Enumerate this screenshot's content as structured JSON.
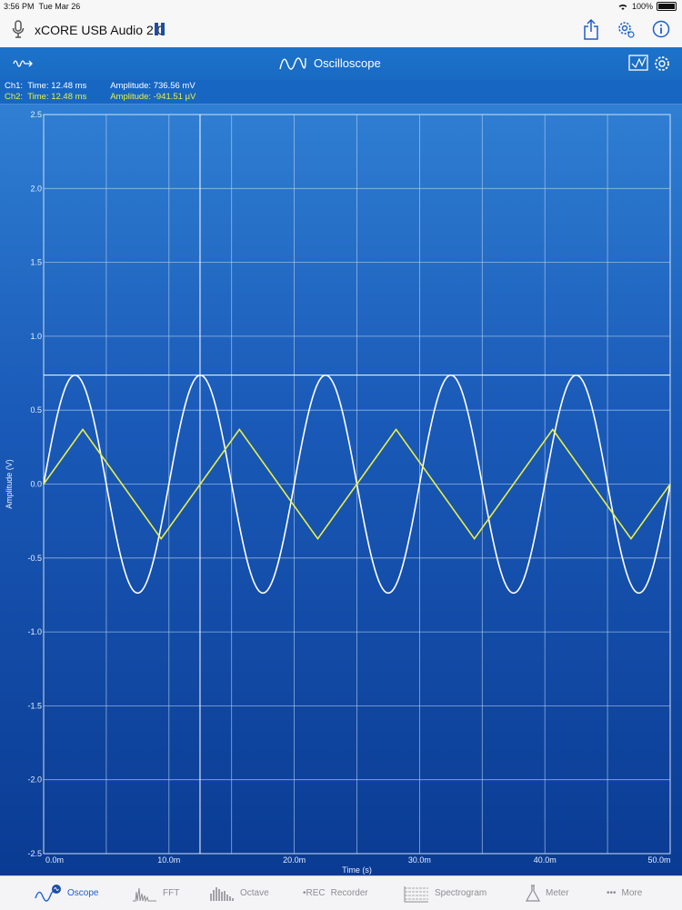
{
  "status_bar": {
    "time": "3:56 PM",
    "date": "Tue Mar 26",
    "battery": "100%",
    "wifi_icon": "wifi-icon",
    "battery_icon": "battery-icon"
  },
  "title_bar": {
    "device_name": "xCORE USB Audio 2.0",
    "mic_icon": "microphone-icon",
    "pause_icon": "pause-icon",
    "share_icon": "share-icon",
    "settings_icon": "gear-icon",
    "info_icon": "info-icon"
  },
  "scope_header": {
    "title": "Oscilloscope",
    "wave_icon": "sine-wave-icon",
    "trigger_icon": "trigger-icon",
    "display_icon": "display-mode-icon",
    "settings_icon": "gear-icon"
  },
  "readout": {
    "ch1_label": "Ch1:",
    "ch1_time": "Time: 12.48 ms",
    "ch1_amp": "Amplitude: 736.56 mV",
    "ch2_label": "Ch2:",
    "ch2_time": "Time: 12.48 ms",
    "ch2_amp": "Amplitude: -941.51 µV"
  },
  "chart_data": {
    "type": "line",
    "xlabel": "Time (s)",
    "ylabel": "Amplitude (V)",
    "xlim": [
      0,
      50
    ],
    "ylim": [
      -2.5,
      2.5
    ],
    "x_ticks": [
      "0.0m",
      "10.0m",
      "20.0m",
      "30.0m",
      "40.0m",
      "50.0m"
    ],
    "y_ticks": [
      "2.5",
      "2.0",
      "1.5",
      "1.0",
      "0.5",
      "0.0",
      "-0.5",
      "-1.0",
      "-1.5",
      "-2.0",
      "-2.5"
    ],
    "grid": true,
    "cursor": {
      "x": 12.48,
      "y": 0.737
    },
    "series": [
      {
        "type": "sine",
        "amplitude": 0.737,
        "period": 10,
        "phase": 0,
        "color": "#ffffff"
      },
      {
        "type": "triangle",
        "amplitude": 0.37,
        "period": 12.5,
        "phase": 0,
        "color": "#e9ef45"
      }
    ]
  },
  "tab_bar": {
    "tabs": [
      {
        "label": "Oscope",
        "icon": "oscope-icon",
        "active": true
      },
      {
        "label": "FFT",
        "icon": "fft-icon",
        "active": false
      },
      {
        "label": "Octave",
        "icon": "octave-icon",
        "active": false
      },
      {
        "label": "Recorder",
        "icon": "rec-icon",
        "active": false,
        "prefix": "•REC"
      },
      {
        "label": "Spectrogram",
        "icon": "spectrogram-icon",
        "active": false
      },
      {
        "label": "Meter",
        "icon": "flask-icon",
        "active": false
      },
      {
        "label": "More",
        "icon": "more-icon",
        "active": false,
        "prefix": "•••"
      }
    ]
  }
}
